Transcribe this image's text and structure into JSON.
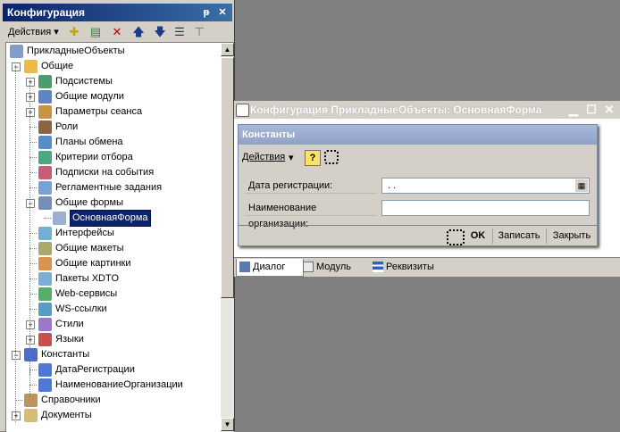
{
  "config_panel": {
    "title": "Конфигурация",
    "pin_glyph": "ᵽ",
    "close_glyph": "✕",
    "toolbar": {
      "actions_label": "Действия ▾",
      "icons": [
        "add-icon",
        "add-child-icon",
        "delete-icon",
        "move-up-icon",
        "move-down-icon",
        "sort-icon",
        "filter-icon"
      ]
    },
    "tree": [
      {
        "label": "ПрикладныеОбъекты",
        "level": 0,
        "expander": "",
        "icon": "config-icon"
      },
      {
        "label": "Общие",
        "level": 1,
        "expander": "−",
        "icon": "common-icon"
      },
      {
        "label": "Подсистемы",
        "level": 2,
        "expander": "+",
        "icon": "subsystems-icon"
      },
      {
        "label": "Общие модули",
        "level": 2,
        "expander": "+",
        "icon": "modules-icon"
      },
      {
        "label": "Параметры сеанса",
        "level": 2,
        "expander": "+",
        "icon": "session-icon"
      },
      {
        "label": "Роли",
        "level": 2,
        "expander": "",
        "icon": "roles-icon"
      },
      {
        "label": "Планы обмена",
        "level": 2,
        "expander": "",
        "icon": "exchange-icon"
      },
      {
        "label": "Критерии отбора",
        "level": 2,
        "expander": "",
        "icon": "criteria-icon"
      },
      {
        "label": "Подписки на события",
        "level": 2,
        "expander": "",
        "icon": "subscriptions-icon"
      },
      {
        "label": "Регламентные задания",
        "level": 2,
        "expander": "",
        "icon": "jobs-icon"
      },
      {
        "label": "Общие формы",
        "level": 2,
        "expander": "−",
        "icon": "forms-icon"
      },
      {
        "label": "ОсновнаяФорма",
        "level": 3,
        "expander": "",
        "icon": "form-icon",
        "selected": true
      },
      {
        "label": "Интерфейсы",
        "level": 2,
        "expander": "",
        "icon": "interfaces-icon"
      },
      {
        "label": "Общие макеты",
        "level": 2,
        "expander": "",
        "icon": "templates-icon"
      },
      {
        "label": "Общие картинки",
        "level": 2,
        "expander": "",
        "icon": "pictures-icon"
      },
      {
        "label": "Пакеты XDTO",
        "level": 2,
        "expander": "",
        "icon": "xdto-icon"
      },
      {
        "label": "Web-сервисы",
        "level": 2,
        "expander": "",
        "icon": "webservice-icon"
      },
      {
        "label": "WS-ссылки",
        "level": 2,
        "expander": "",
        "icon": "wslink-icon"
      },
      {
        "label": "Стили",
        "level": 2,
        "expander": "+",
        "icon": "styles-icon"
      },
      {
        "label": "Языки",
        "level": 2,
        "expander": "+",
        "icon": "languages-icon"
      },
      {
        "label": "Константы",
        "level": 1,
        "expander": "−",
        "icon": "constants-icon"
      },
      {
        "label": "ДатаРегистрации",
        "level": 2,
        "expander": "",
        "icon": "constant-icon"
      },
      {
        "label": "НаименованиеОрганизации",
        "level": 2,
        "expander": "",
        "icon": "constant-icon"
      },
      {
        "label": "Справочники",
        "level": 1,
        "expander": "",
        "icon": "catalogs-icon"
      },
      {
        "label": "Документы",
        "level": 1,
        "expander": "+",
        "icon": "documents-icon"
      }
    ]
  },
  "form_window": {
    "title": "Конфигурация ПрикладныеОбъекты: ОсновнаяФорма",
    "dialog": {
      "title": "Константы",
      "actions_label": "Действия",
      "actions_arrow": "▾",
      "help_glyph": "?",
      "fields": [
        {
          "label": "Дата регистрации:",
          "value": " .  ."
        },
        {
          "label": "Наименование организации:",
          "value": ""
        }
      ],
      "buttons": {
        "ok": "OK",
        "write": "Записать",
        "close": "Закрыть"
      }
    },
    "tabs": [
      {
        "label": "Диалог",
        "icon": "dialog-tab-icon",
        "active": true
      },
      {
        "label": "Модуль",
        "icon": "module-tab-icon",
        "active": false
      },
      {
        "label": "Реквизиты",
        "icon": "attributes-tab-icon",
        "active": false
      }
    ]
  },
  "colors": {
    "titlebar_active": "#0a246a",
    "titlebar_inactive": "#8fa2c8",
    "window_bg": "#d4d0c8",
    "desktop": "#808080"
  }
}
